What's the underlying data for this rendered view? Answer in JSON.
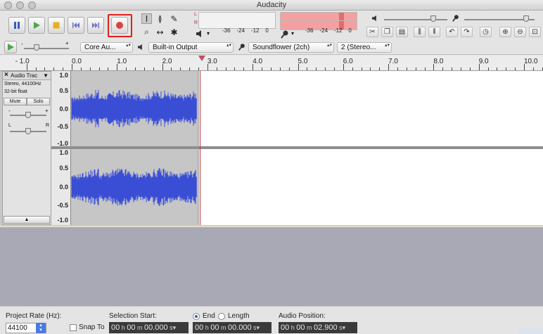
{
  "window": {
    "title": "Audacity"
  },
  "transport": {
    "pause": "Pause",
    "play": "Play",
    "stop": "Stop",
    "skip_start": "Skip to Start",
    "skip_end": "Skip to End",
    "record": "Record",
    "record_highlight_color": "#e0201a"
  },
  "tools": {
    "selection": "I",
    "envelope": "≬",
    "draw": "✎",
    "zoom": "⌕",
    "timeshift": "↔",
    "multi": "✱"
  },
  "meters": {
    "playback_scale": [
      "-36",
      "-24",
      "-12",
      "0"
    ],
    "record_scale": [
      "-36",
      "-24",
      "-12",
      "0"
    ],
    "left_label": "L",
    "right_label": "R"
  },
  "devices": {
    "host": "Core Au...",
    "output": "Built-in Output",
    "input": "Soundflower (2ch)",
    "channels": "2 (Stereo..."
  },
  "ruler": {
    "labels": [
      "- 1.0",
      "0.0",
      "1.0",
      "2.0",
      "3.0",
      "4.0",
      "5.0",
      "6.0",
      "7.0",
      "8.0",
      "9.0",
      "10.0"
    ]
  },
  "track": {
    "name": "Audio Trac",
    "info_line1": "Stereo, 44100Hz",
    "info_line2": "32-bit float",
    "mute": "Mute",
    "solo": "Solo",
    "gain_minus": "-",
    "gain_plus": "+",
    "pan_left": "L",
    "pan_right": "R",
    "collapse": "▲",
    "close": "×",
    "menu": "▼",
    "vruler_labels": [
      "1.0",
      "0.5",
      "0.0",
      "-0.5",
      "-1.0"
    ],
    "waveform_color": "#3b4fd6",
    "clip_background": "#c6c6c6"
  },
  "selection_bar": {
    "project_rate_label": "Project Rate (Hz):",
    "project_rate": "44100",
    "snap_to": "Snap To",
    "selection_start_label": "Selection Start:",
    "end_label": "End",
    "length_label": "Length",
    "audio_position_label": "Audio Position:",
    "selection_start": {
      "h": "00",
      "m": "00",
      "s": "00.000"
    },
    "selection_end": {
      "h": "00",
      "m": "00",
      "s": "00.000"
    },
    "audio_position": {
      "h": "00",
      "m": "00",
      "s": "02.900"
    }
  }
}
